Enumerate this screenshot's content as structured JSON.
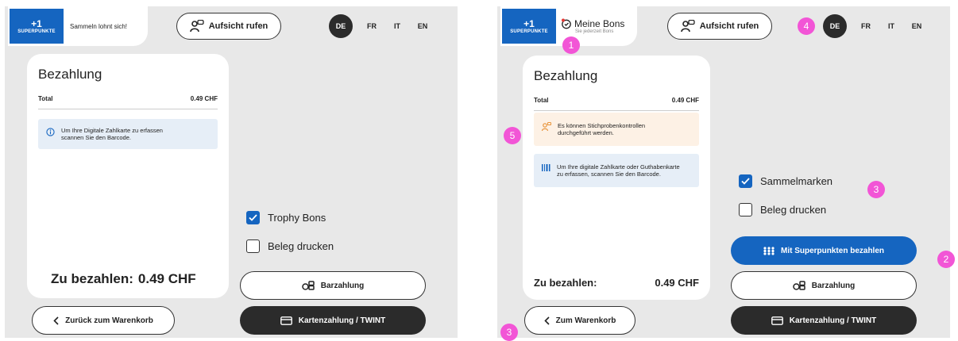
{
  "left": {
    "promo": {
      "points": "+1",
      "points_label": "SUPERPUNKTE",
      "text": "Sammeln lohnt sich!"
    },
    "aufsicht": "Aufsicht rufen",
    "languages": [
      "DE",
      "FR",
      "IT",
      "EN"
    ],
    "active_language": "DE",
    "card": {
      "title": "Bezahlung",
      "total_label": "Total",
      "total_value": "0.49 CHF",
      "info_line1": "Um Ihre Digitale Zahlkarte zu erfassen",
      "info_line2": "scannen Sie den Barcode.",
      "pay_label": "Zu bezahlen:",
      "pay_value": "0.49 CHF"
    },
    "options": [
      {
        "label": "Trophy Bons",
        "checked": true
      },
      {
        "label": "Beleg drucken",
        "checked": false
      }
    ],
    "buttons": {
      "cash": "Barzahlung",
      "card": "Kartenzahlung / TWINT",
      "back": "Zurück zum Warenkorb"
    }
  },
  "right": {
    "promo": {
      "points": "+1",
      "points_label": "SUPERPUNKTE",
      "title": "Meine Bons",
      "subtitle": "Sie jederzeit Bons"
    },
    "aufsicht": "Aufsicht rufen",
    "languages": [
      "DE",
      "FR",
      "IT",
      "EN"
    ],
    "active_language": "DE",
    "card": {
      "title": "Bezahlung",
      "total_label": "Total",
      "total_value": "0.49 CHF",
      "warn_line1": "Es können Stichprobenkontrollen",
      "warn_line2": "durchgeführt werden.",
      "info_line1": "Um Ihre digitale Zahlkarte oder Guthabenkarte",
      "info_line2": "zu erfassen, scannen Sie den Barcode.",
      "pay_label": "Zu bezahlen:",
      "pay_value": "0.49 CHF"
    },
    "options": [
      {
        "label": "Sammelmarken",
        "checked": true
      },
      {
        "label": "Beleg drucken",
        "checked": false
      }
    ],
    "buttons": {
      "superpoints": "Mit Superpunkten bezahlen",
      "cash": "Barzahlung",
      "card": "Kartenzahlung / TWINT",
      "back": "Zum Warenkorb"
    }
  },
  "markers": [
    "1",
    "2",
    "3",
    "3",
    "4",
    "5"
  ],
  "colors": {
    "brand_blue": "#1565c0",
    "dark": "#2b2b2b",
    "marker": "#f255d6",
    "info_bg": "#e6eef7",
    "warn_bg": "#fdf1e5"
  }
}
